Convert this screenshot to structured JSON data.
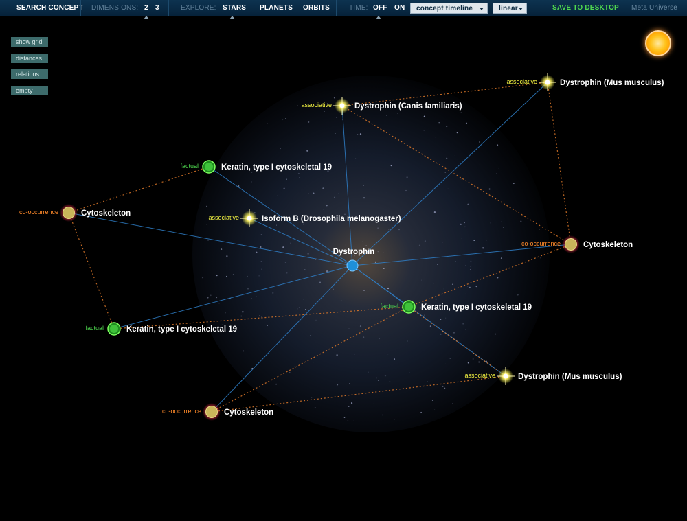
{
  "toolbar": {
    "search_concept": "SEARCH CONCEPT",
    "dimensions_label": "DIMENSIONS:",
    "dim_2": "2",
    "dim_3": "3",
    "explore_label": "EXPLORE:",
    "stars": "STARS",
    "planets": "PLANETS",
    "orbits": "ORBITS",
    "time_label": "TIME:",
    "off": "OFF",
    "on": "ON",
    "timeline_select": "concept timeline",
    "scale_select": "linear",
    "save": "SAVE TO DESKTOP",
    "meta": "Meta Universe"
  },
  "side_buttons": [
    "show grid",
    "distances",
    "relations",
    "empty"
  ],
  "center": {
    "label": "Dystrophin",
    "color": "#1e8fd8"
  },
  "colors": {
    "factual": "#4fd84f",
    "associative": "#f5f542",
    "co_occurrence": "#ff8a2a",
    "link": "#2f7fc8"
  },
  "nodes": [
    {
      "label": "Dystrophin (Mus musculus)",
      "relation": "associative",
      "kind": "star"
    },
    {
      "label": "Dystrophin (Canis familiaris)",
      "relation": "associative",
      "kind": "star"
    },
    {
      "label": "Keratin, type I cytoskeletal 19",
      "relation": "factual",
      "kind": "green"
    },
    {
      "label": "Cytoskeleton",
      "relation": "co-occurrence",
      "kind": "planet"
    },
    {
      "label": "Isoform B (Drosophila melanogaster)",
      "relation": "associative",
      "kind": "star"
    },
    {
      "label": "Cytoskeleton",
      "relation": "co-occurrence",
      "kind": "planet"
    },
    {
      "label": "Keratin, type I cytoskeletal 19",
      "relation": "factual",
      "kind": "green"
    },
    {
      "label": "Keratin, type I cytoskeletal 19",
      "relation": "factual",
      "kind": "green"
    },
    {
      "label": "Dystrophin (Mus musculus)",
      "relation": "associative",
      "kind": "star"
    },
    {
      "label": "Cytoskeleton",
      "relation": "co-occurrence",
      "kind": "planet"
    }
  ],
  "dotted_links": [
    [
      0,
      1
    ],
    [
      0,
      5
    ],
    [
      1,
      5
    ],
    [
      2,
      3
    ],
    [
      3,
      7
    ],
    [
      5,
      6
    ],
    [
      6,
      8
    ],
    [
      6,
      9
    ],
    [
      9,
      8
    ],
    [
      7,
      6
    ]
  ]
}
